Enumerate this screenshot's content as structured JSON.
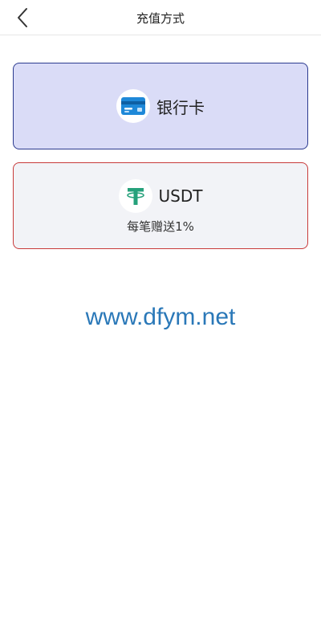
{
  "header": {
    "title": "充值方式"
  },
  "methods": [
    {
      "label": "银行卡",
      "icon": "bank-card-icon",
      "colors": {
        "background": "#dadcf7",
        "border": "#2b3a8f",
        "icon": "#1e88d8"
      }
    },
    {
      "label": "USDT",
      "subtitle": "每笔赠送1%",
      "icon": "tether-icon",
      "colors": {
        "background": "#f2f3f7",
        "border": "#c83a3a",
        "icon": "#26a17b"
      }
    }
  ],
  "watermark": {
    "text": "www.dfym.net",
    "color": "#2a78b8"
  }
}
